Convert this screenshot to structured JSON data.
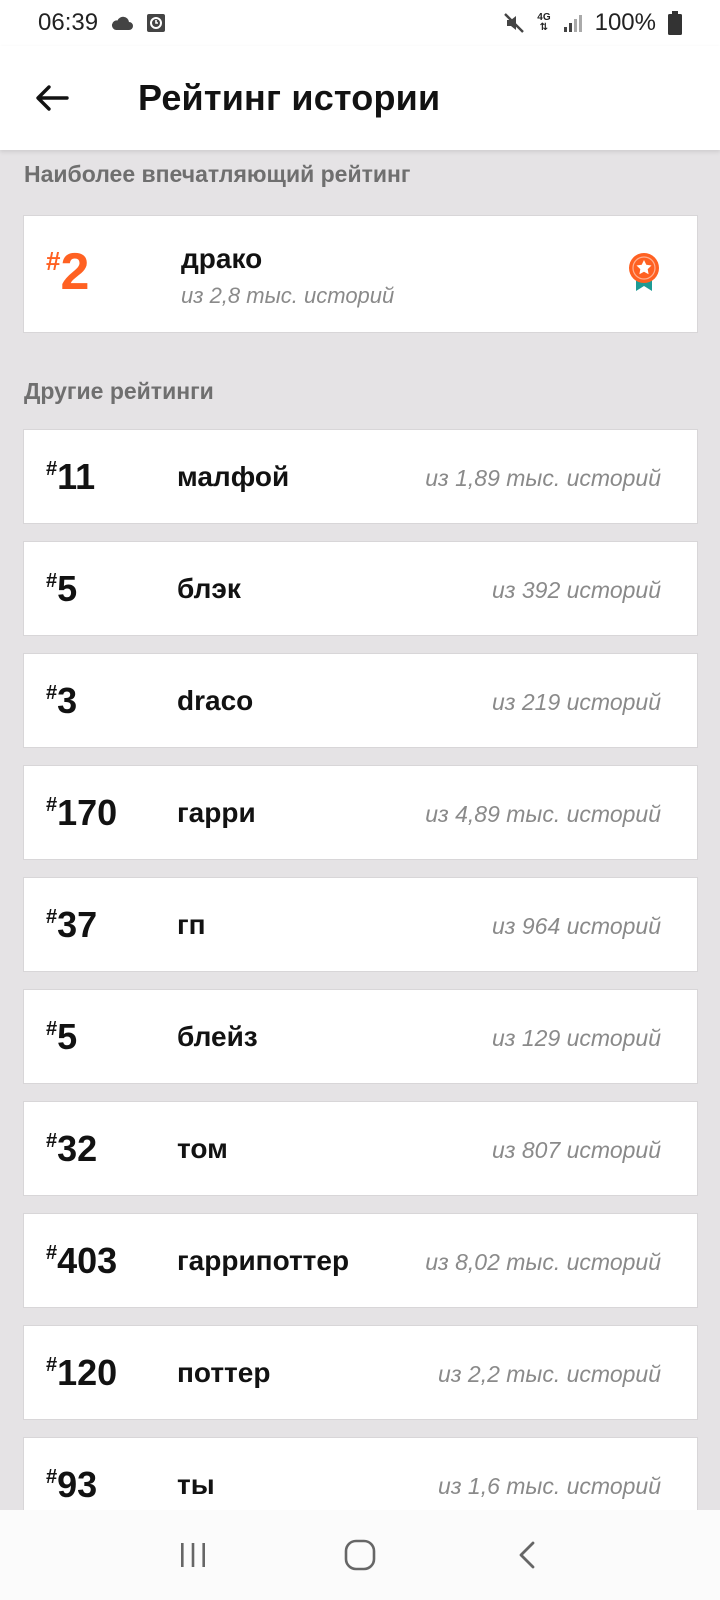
{
  "status_bar": {
    "time": "06:39",
    "network": "4G",
    "battery": "100%"
  },
  "header": {
    "title": "Рейтинг истории"
  },
  "featured": {
    "section_title": "Наиболее впечатляющий рейтинг",
    "rank_hash": "#",
    "rank": "2",
    "tag": "драко",
    "subtitle": "из 2,8 тыс. историй",
    "accent_color": "#ff6122"
  },
  "others": {
    "section_title": "Другие рейтинги",
    "items": [
      {
        "hash": "#",
        "rank": "11",
        "tag": "малфой",
        "subtitle": "из 1,89 тыс. историй"
      },
      {
        "hash": "#",
        "rank": "5",
        "tag": "блэк",
        "subtitle": "из 392 историй"
      },
      {
        "hash": "#",
        "rank": "3",
        "tag": "draco",
        "subtitle": "из 219 историй"
      },
      {
        "hash": "#",
        "rank": "170",
        "tag": "гарри",
        "subtitle": "из 4,89 тыс. историй"
      },
      {
        "hash": "#",
        "rank": "37",
        "tag": "гп",
        "subtitle": "из 964 историй"
      },
      {
        "hash": "#",
        "rank": "5",
        "tag": "блейз",
        "subtitle": "из 129 историй"
      },
      {
        "hash": "#",
        "rank": "32",
        "tag": "том",
        "subtitle": "из 807 историй"
      },
      {
        "hash": "#",
        "rank": "403",
        "tag": "гаррипоттер",
        "subtitle": "из 8,02 тыс. историй"
      },
      {
        "hash": "#",
        "rank": "120",
        "tag": "поттер",
        "subtitle": "из 2,2 тыс. историй"
      },
      {
        "hash": "#",
        "rank": "93",
        "tag": "ты",
        "subtitle": "из 1,6 тыс. историй"
      }
    ]
  },
  "icons": {
    "back": "arrow-left-icon",
    "medal": "medal-icon",
    "cloud": "cloud-icon",
    "clock": "alarm-icon",
    "mute": "mute-icon",
    "signal": "signal-icon",
    "battery": "battery-icon",
    "nav_recents": "recents-icon",
    "nav_home": "home-icon",
    "nav_back": "nav-back-icon"
  }
}
